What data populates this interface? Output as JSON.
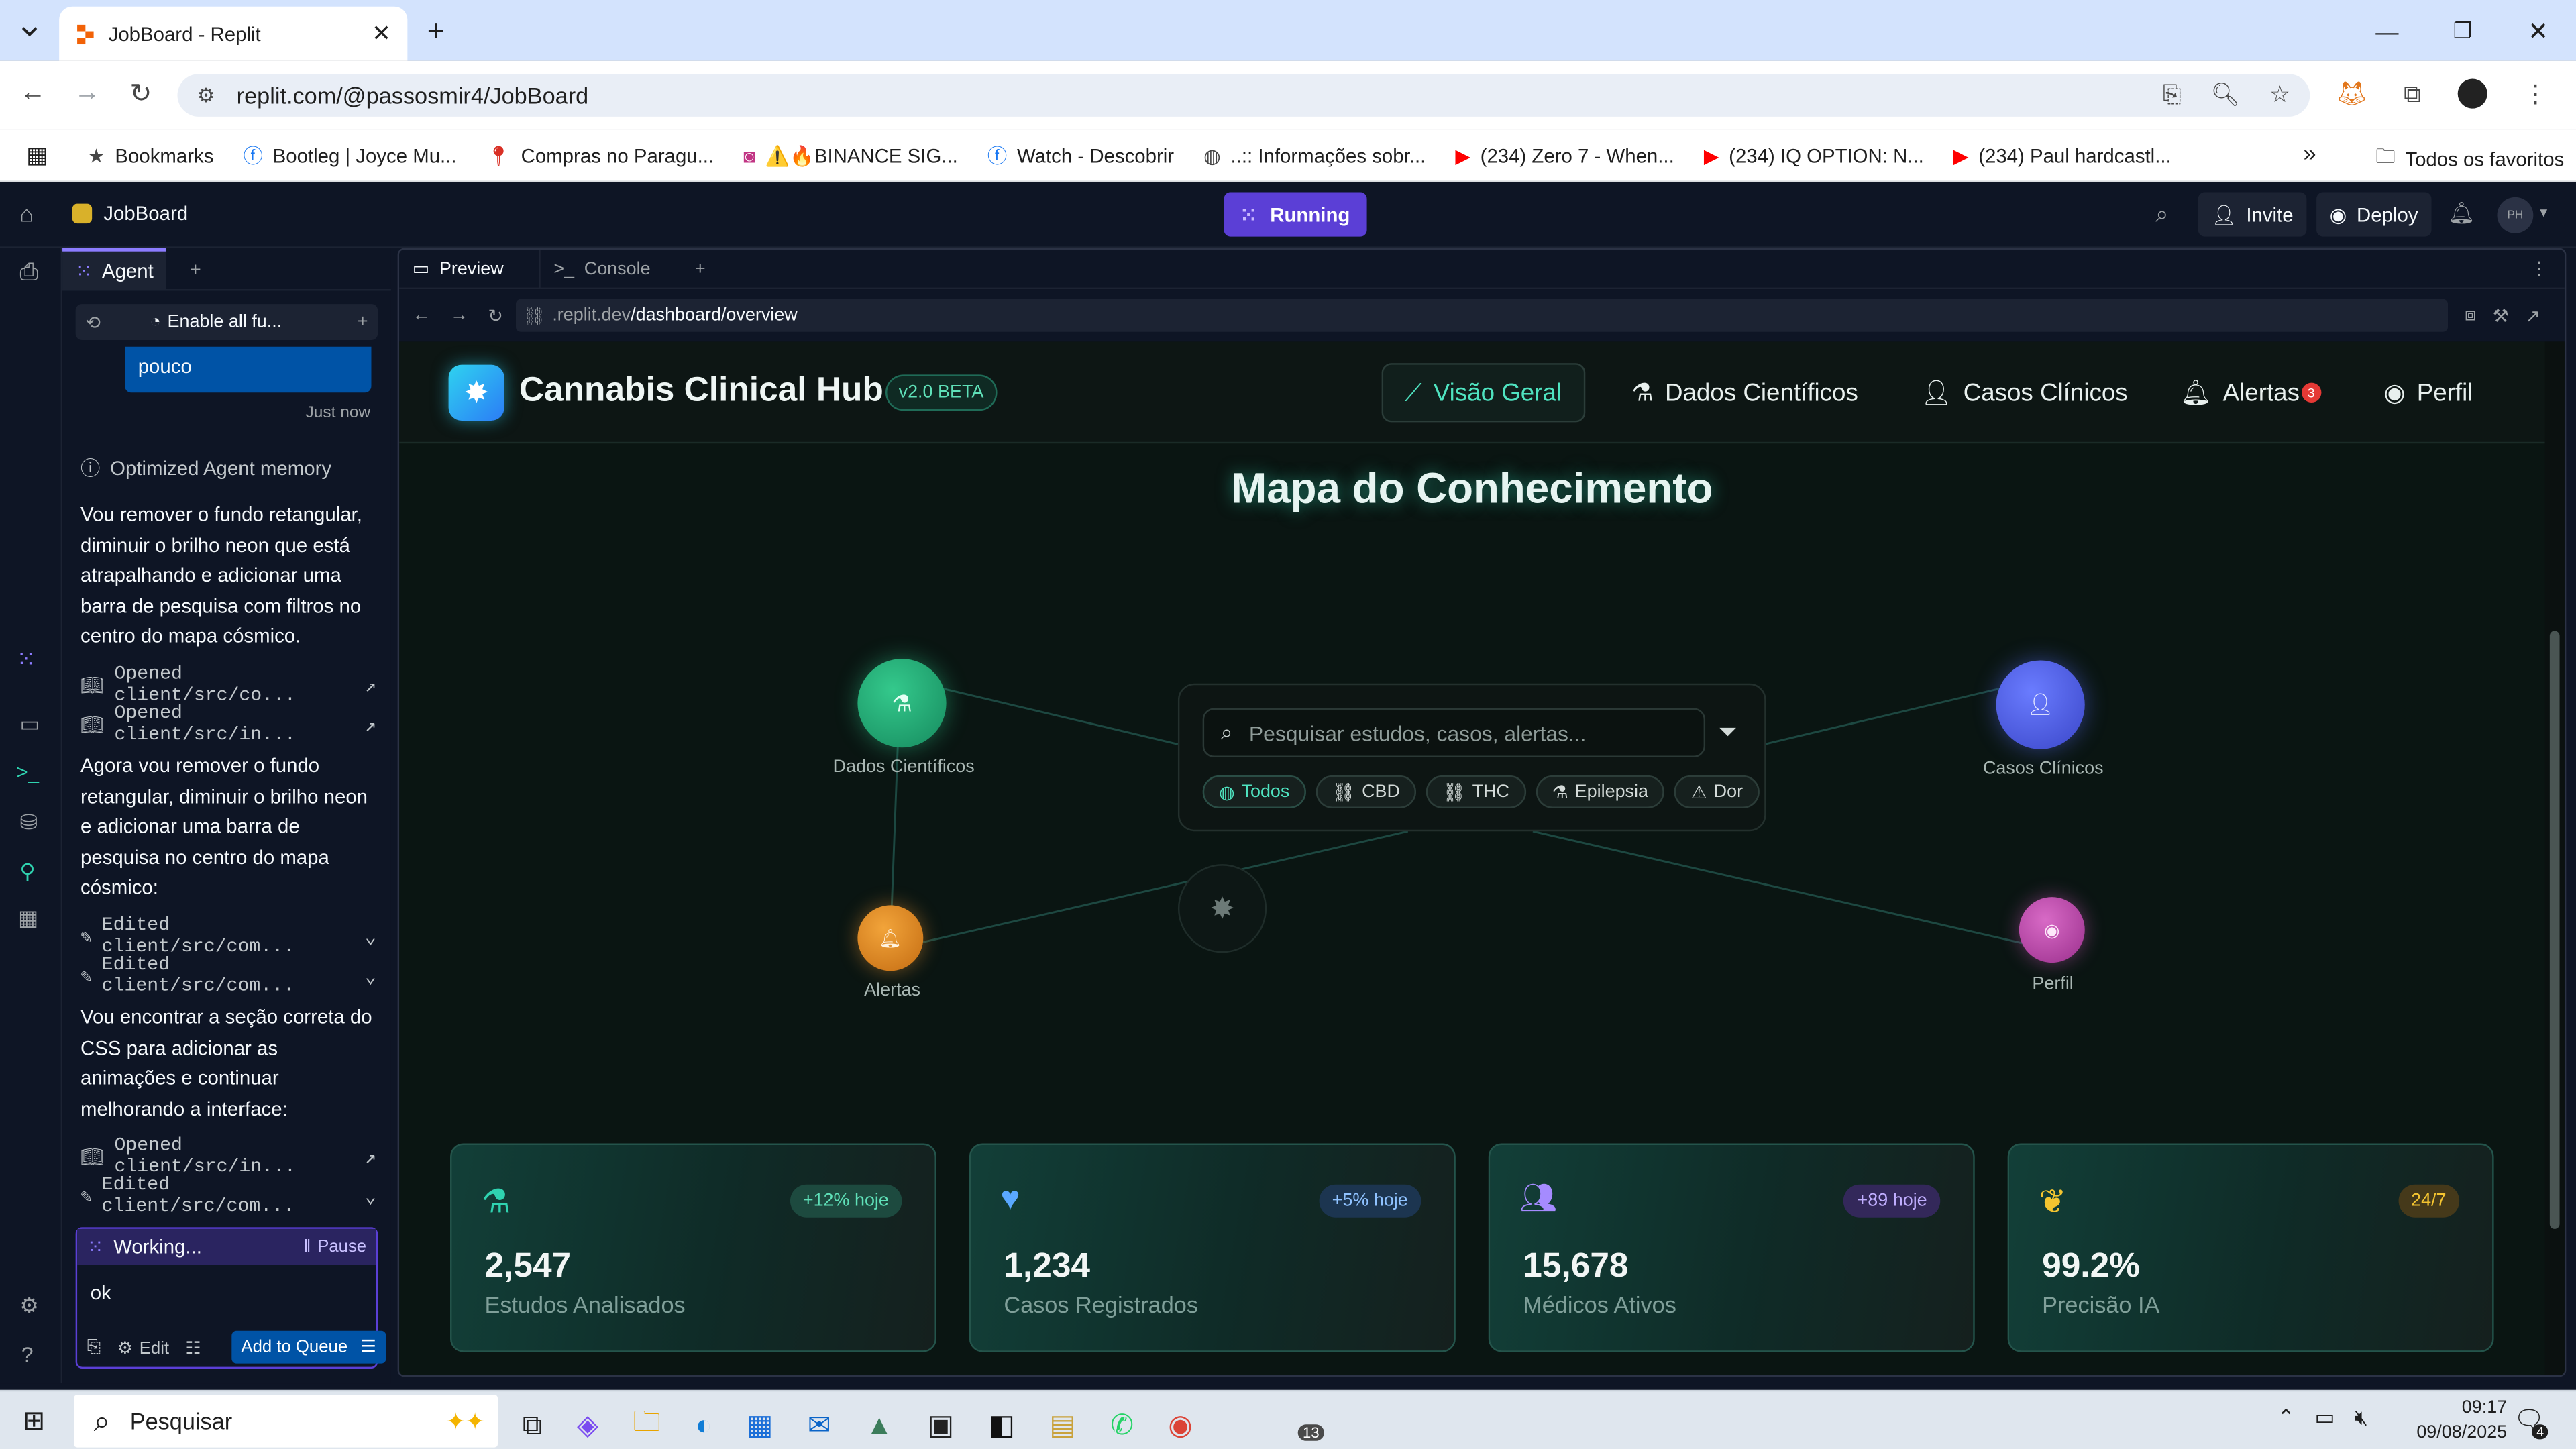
{
  "browser": {
    "tab_title": "JobBoard - Replit",
    "url": "replit.com/@passosmir4/JobBoard",
    "bookmarks": [
      "Bookmarks",
      "Bootleg | Joyce Mu...",
      "Compras no Paragu...",
      "⚠️🔥BINANCE SIG...",
      "Watch - Descobrir",
      "..:: Informações sobr...",
      "(234) Zero 7 - When...",
      "(234) IQ OPTION: N...",
      "(234) Paul hardcastl..."
    ],
    "all_bookmarks": "Todos os favoritos"
  },
  "replit": {
    "project": "JobBoard",
    "run_status": "Running",
    "invite": "Invite",
    "deploy": "Deploy",
    "avatar": "PH",
    "agent_tab": "Agent",
    "preview_tab": "Preview",
    "console_tab": "Console",
    "preview_url_prefix": ".replit.dev",
    "preview_url_path": "/dashboard/overview"
  },
  "agent": {
    "toolbar_label": "Enable all fu...",
    "user_msg": "pouco",
    "user_time": "Just now",
    "memory": "Optimized Agent memory",
    "msg1": "Vou remover o fundo retangular, diminuir o brilho neon que está atrapalhando e adicionar uma barra de pesquisa com filtros no centro do mapa cósmico.",
    "act1": "Opened client/src/co...",
    "act2": "Opened client/src/in...",
    "msg2": "Agora vou remover o fundo retangular, diminuir o brilho neon e adicionar uma barra de pesquisa no centro do mapa cósmico:",
    "act3": "Edited client/src/com...",
    "act4": "Edited client/src/com...",
    "msg3": "Vou encontrar a seção correta do CSS para adicionar as animações e continuar melhorando a interface:",
    "act5": "Opened client/src/in...",
    "act6": "Edited client/src/com...",
    "working": "Working...",
    "pause": "Pause",
    "input_value": "ok",
    "edit": "Edit",
    "add_queue": "Add to Queue"
  },
  "app": {
    "brand": "Cannabis Clinical Hub",
    "version": "v2.0 BETA",
    "nav": {
      "overview": "Visão Geral",
      "science": "Dados Científicos",
      "cases": "Casos Clínicos",
      "alerts": "Alertas",
      "alerts_count": "3",
      "profile": "Perfil"
    },
    "map_title": "Mapa do Conhecimento",
    "search_placeholder": "Pesquisar estudos, casos, alertas...",
    "filters": [
      "Todos",
      "CBD",
      "THC",
      "Epilepsia",
      "Dor"
    ],
    "nodes": {
      "science": "Dados Científicos",
      "cases": "Casos Clínicos",
      "alerts": "Alertas",
      "profile": "Perfil"
    },
    "stats": [
      {
        "value": "2,547",
        "label": "Estudos Analisados",
        "badge": "+12% hoje",
        "color": "#2fd3b0"
      },
      {
        "value": "1,234",
        "label": "Casos Registrados",
        "badge": "+5% hoje",
        "color": "#5aa8ff"
      },
      {
        "value": "15,678",
        "label": "Médicos Ativos",
        "badge": "+89 hoje",
        "color": "#a58bff"
      },
      {
        "value": "99.2%",
        "label": "Precisão IA",
        "badge": "24/7",
        "color": "#f4c430"
      }
    ]
  },
  "taskbar": {
    "search": "Pesquisar",
    "whatsapp_count": "13",
    "time": "09:17",
    "date": "09/08/2025",
    "notif_count": "4"
  },
  "colors": {
    "accent": "#2fd3b0",
    "replit_run": "#5b3fd6",
    "bg": "#0a1512"
  }
}
